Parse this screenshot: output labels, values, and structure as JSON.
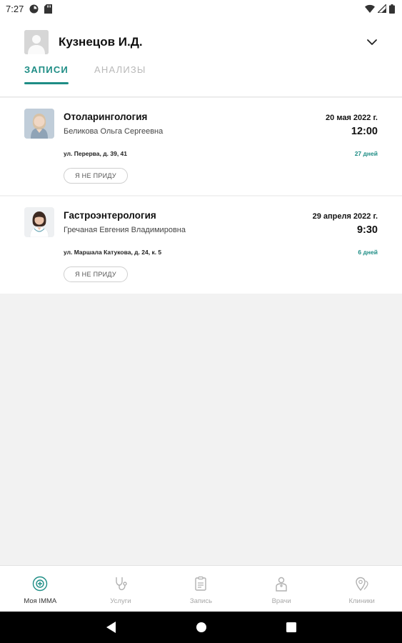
{
  "status_bar": {
    "time": "7:27"
  },
  "header": {
    "profile_name": "Кузнецов И.Д.",
    "tabs": [
      {
        "label": "ЗАПИСИ",
        "active": true
      },
      {
        "label": "АНАЛИЗЫ",
        "active": false
      }
    ]
  },
  "appointments": [
    {
      "specialty": "Отоларингология",
      "doctor": "Беликова Ольга Сергеевна",
      "date": "20 мая 2022 г.",
      "time": "12:00",
      "address": "ул. Перерва, д. 39, 41",
      "days_left": "27 дней",
      "cancel_label": "Я НЕ ПРИДУ"
    },
    {
      "specialty": "Гастроэнтерология",
      "doctor": "Гречаная Евгения Владимировна",
      "date": "29 апреля 2022 г.",
      "time": "9:30",
      "address": "ул. Маршала Катукова, д. 24, к. 5",
      "days_left": "6 дней",
      "cancel_label": "Я НЕ ПРИДУ"
    }
  ],
  "bottom_nav": [
    {
      "label": "Моя IMMA",
      "icon": "home-icon",
      "active": true
    },
    {
      "label": "Услуги",
      "icon": "stethoscope-icon",
      "active": false
    },
    {
      "label": "Запись",
      "icon": "clipboard-icon",
      "active": false
    },
    {
      "label": "Врачи",
      "icon": "doctor-icon",
      "active": false
    },
    {
      "label": "Клиники",
      "icon": "map-pin-icon",
      "active": false
    }
  ],
  "colors": {
    "accent": "#1e8d85",
    "inactive": "#b9b9b9",
    "background": "#f2f2f2"
  }
}
